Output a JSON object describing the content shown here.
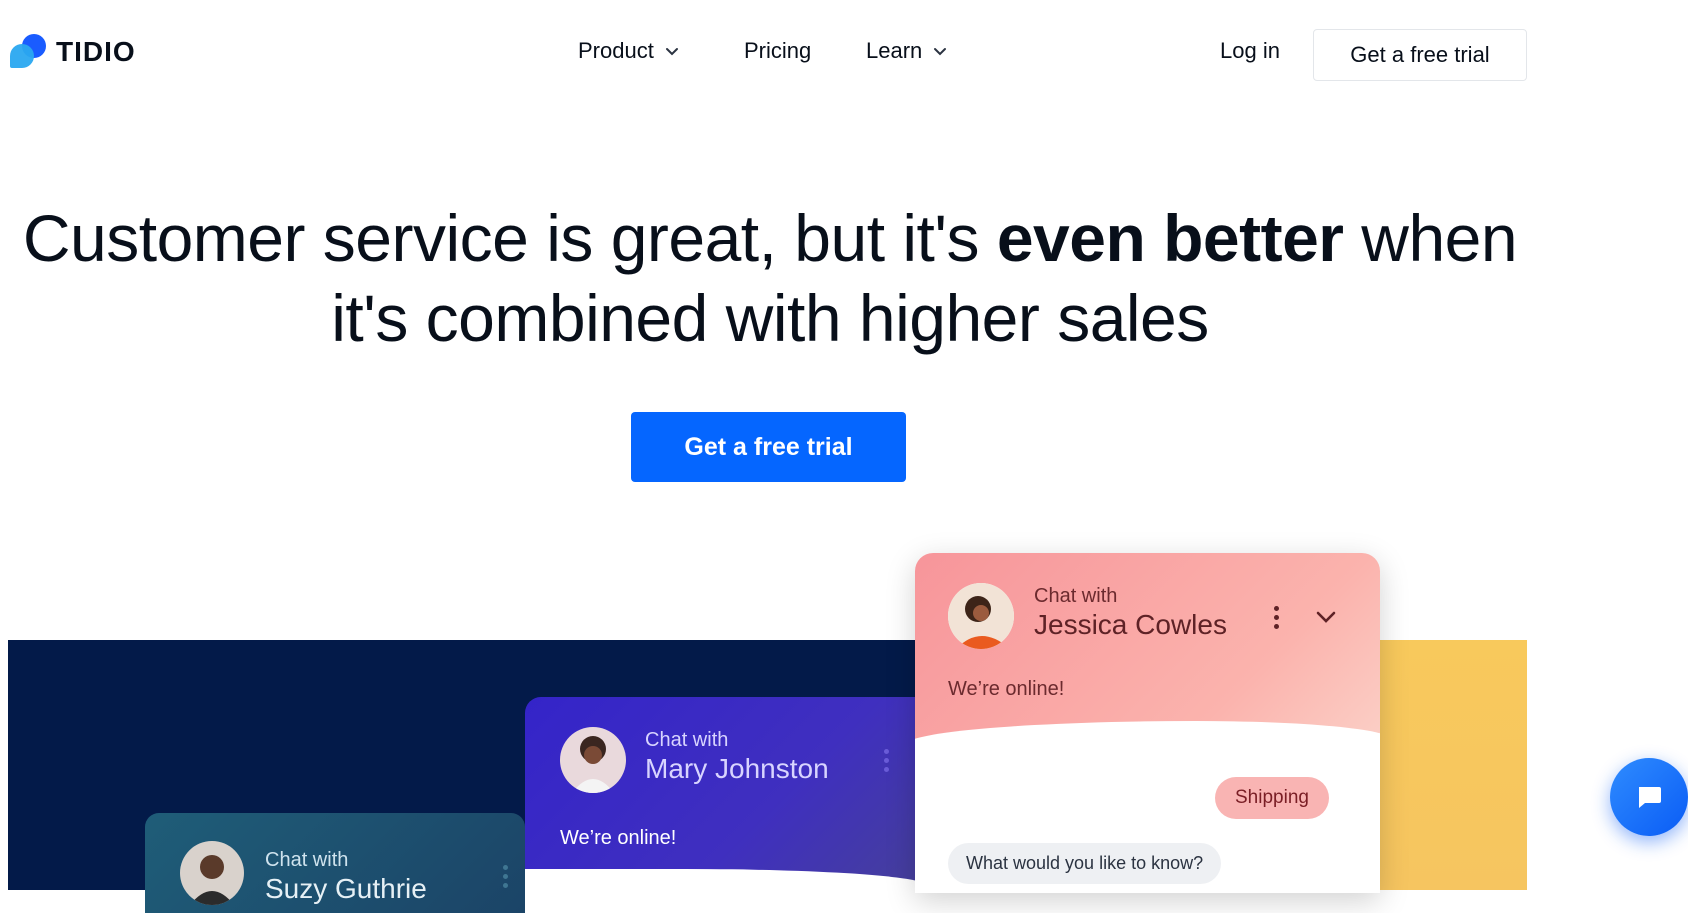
{
  "header": {
    "logo_text": "TIDIO",
    "nav": [
      {
        "label": "Product",
        "dropdown": true
      },
      {
        "label": "Pricing",
        "dropdown": false
      },
      {
        "label": "Learn",
        "dropdown": true
      }
    ],
    "login": "Log in",
    "cta": "Get a free trial"
  },
  "hero": {
    "line1_a": "Customer service is great, but it's ",
    "line1_bold": "even better",
    "line1_b": " when",
    "line2": "it's combined with higher sales",
    "cta": "Get a free trial"
  },
  "chats": {
    "suzy": {
      "chat_with": "Chat with",
      "name": "Suzy Guthrie"
    },
    "mary": {
      "chat_with": "Chat with",
      "name": "Mary Johnston",
      "status": "We’re online!"
    },
    "jessica": {
      "chat_with": "Chat with",
      "name": "Jessica Cowles",
      "status": "We’re online!",
      "shipping": "Shipping",
      "question": "What would you like to know?"
    }
  },
  "colors": {
    "accent": "#0566ff",
    "navy": "#031a49",
    "yellow": "#f8c95c",
    "pink": "#f7959a",
    "purple": "#3424c9"
  },
  "icons": [
    "chat-bubble-icon",
    "chevron-down-icon",
    "more-vertical-icon"
  ]
}
